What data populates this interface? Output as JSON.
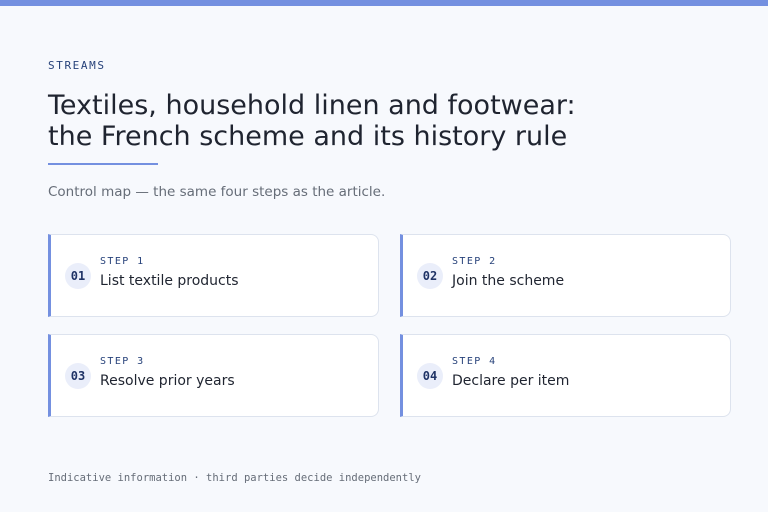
{
  "header": {
    "eyebrow": "STREAMS",
    "title_line1": "Textiles, household linen and footwear:",
    "title_line2": "the French scheme and its history rule",
    "subtitle": "Control map — the same four steps as the article."
  },
  "steps": [
    {
      "number": "01",
      "label": "STEP 1",
      "text": "List textile products"
    },
    {
      "number": "02",
      "label": "STEP 2",
      "text": "Join the scheme"
    },
    {
      "number": "03",
      "label": "STEP 3",
      "text": "Resolve prior years"
    },
    {
      "number": "04",
      "label": "STEP 4",
      "text": "Declare per item"
    }
  ],
  "footer": {
    "note": "Indicative information · third parties decide independently"
  },
  "colors": {
    "accent": "#7490e0",
    "background": "#f7f9fd",
    "card_background": "#ffffff",
    "eyebrow": "#27427a"
  }
}
